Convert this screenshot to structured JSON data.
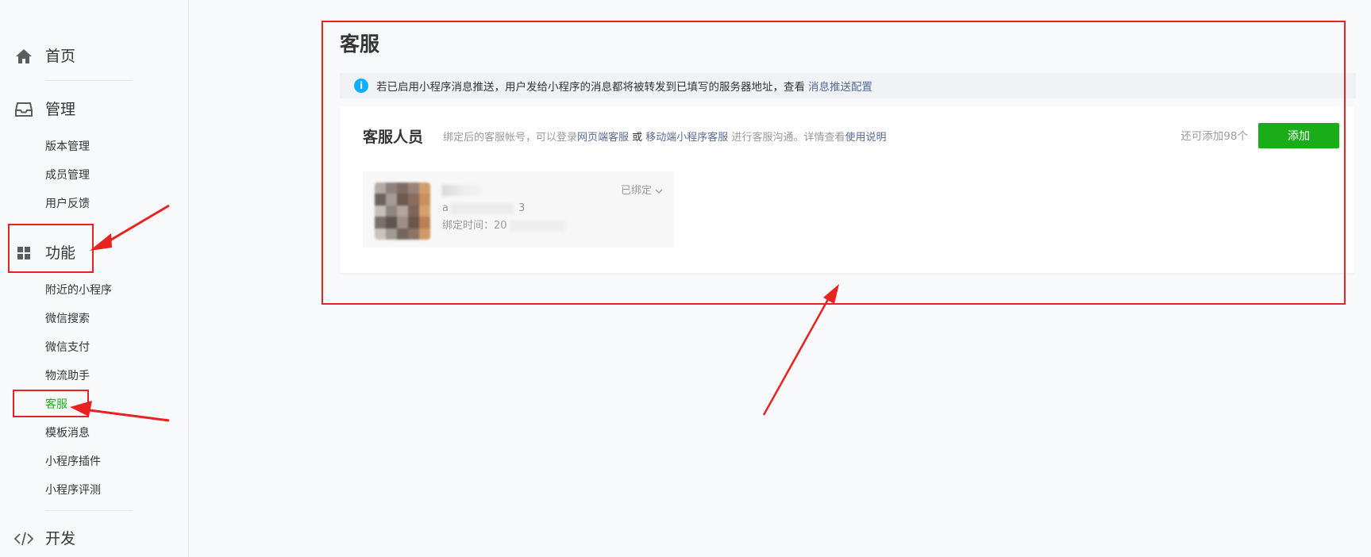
{
  "sidebar": {
    "home": {
      "label": "首页",
      "icon": "home-icon"
    },
    "manage": {
      "label": "管理",
      "icon": "inbox-icon",
      "items": [
        "版本管理",
        "成员管理",
        "用户反馈"
      ]
    },
    "features": {
      "label": "功能",
      "icon": "grid-icon",
      "items": [
        "附近的小程序",
        "微信搜索",
        "微信支付",
        "物流助手",
        "客服",
        "模板消息",
        "小程序插件",
        "小程序评测"
      ],
      "active_index": 4
    },
    "develop": {
      "label": "开发",
      "icon": "code-icon"
    }
  },
  "main": {
    "title": "客服",
    "notice": {
      "text": "若已启用小程序消息推送，用户发给小程序的消息都将被转发到已填写的服务器地址，查看",
      "link": "消息推送配置",
      "icon": "info-icon"
    },
    "staff": {
      "title": "客服人员",
      "desc_prefix": "绑定后的客服帐号，可以登录",
      "desc_link1": "网页端客服",
      "desc_or": " 或 ",
      "desc_link2": "移动端小程序客服",
      "desc_mid": " 进行客服沟通。详情查看",
      "desc_link3": "使用说明",
      "remaining": "还可添加98个",
      "add_label": "添加",
      "member": {
        "id_prefix": "a",
        "id_suffix": "3",
        "bind_time_label": "绑定时间：20",
        "status": "已绑定"
      }
    }
  },
  "colors": {
    "accent_green": "#1aad19",
    "link_blue": "#576b95",
    "info_blue": "#10aeff",
    "annotation_red": "#e8231f"
  }
}
